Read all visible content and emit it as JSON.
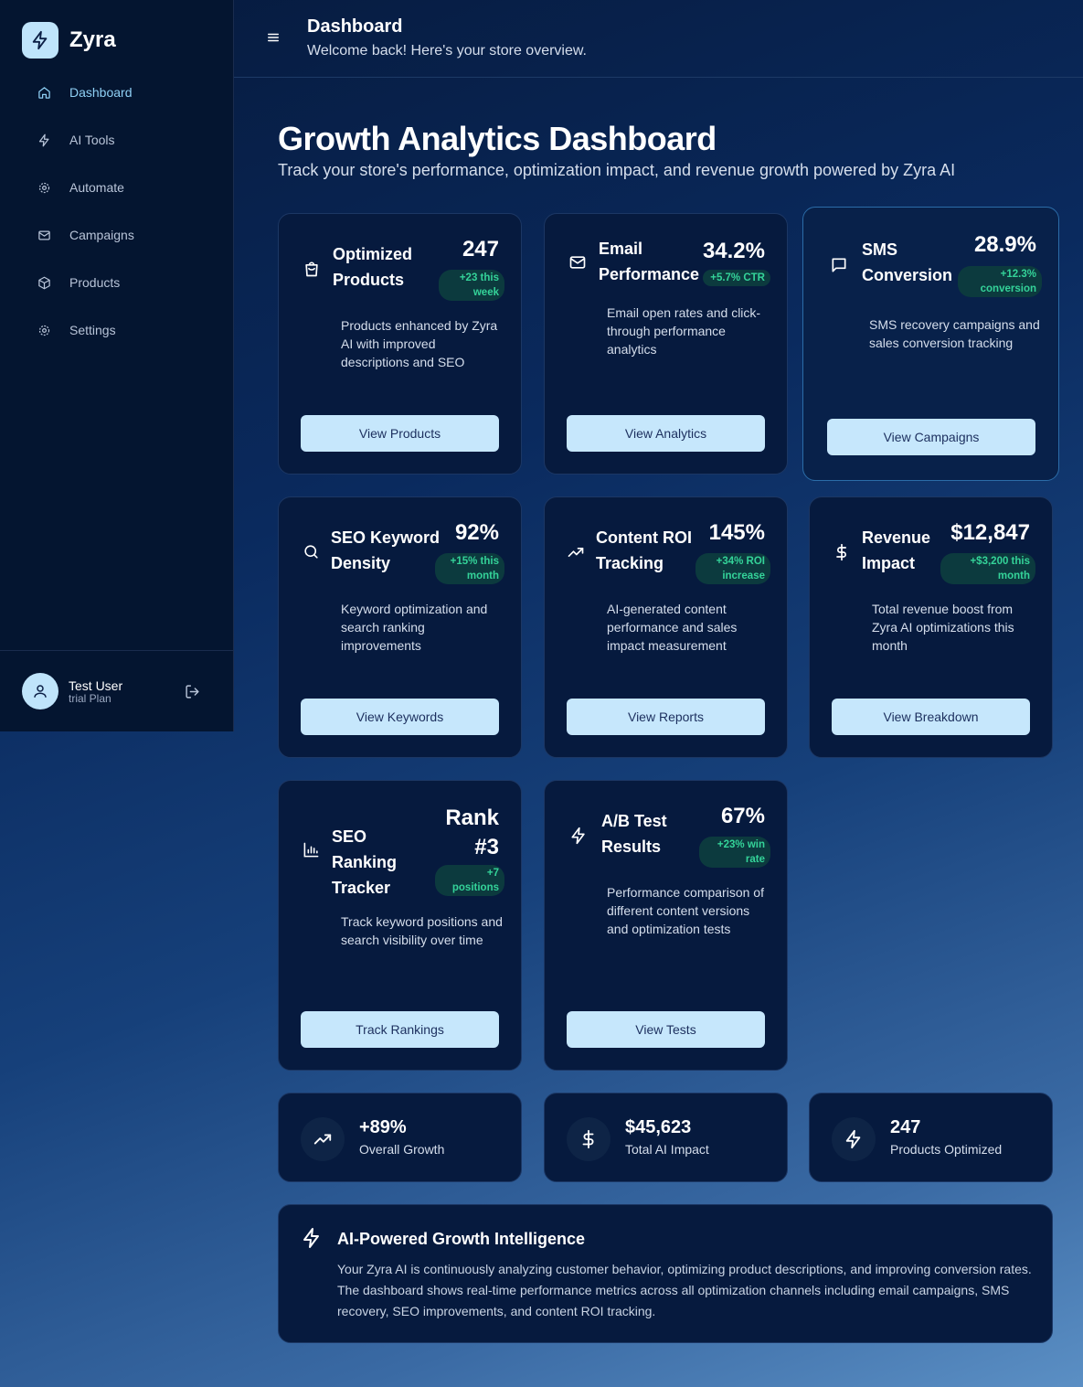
{
  "brand": {
    "name": "Zyra",
    "logo_icon": "lightning-bolt-icon"
  },
  "sidebar": {
    "items": [
      {
        "label": "Dashboard",
        "icon": "home-icon",
        "active": true
      },
      {
        "label": "AI Tools",
        "icon": "lightning-icon"
      },
      {
        "label": "Automate",
        "icon": "gear-icon"
      },
      {
        "label": "Campaigns",
        "icon": "mail-icon"
      },
      {
        "label": "Products",
        "icon": "box-icon"
      },
      {
        "label": "Settings",
        "icon": "settings-icon"
      }
    ],
    "user": {
      "name": "Test User",
      "plan": "trial Plan"
    }
  },
  "header": {
    "title": "Dashboard",
    "subtitle": "Welcome back! Here's your store overview."
  },
  "page": {
    "title": "Growth Analytics Dashboard",
    "subtitle": "Track your store's performance, optimization impact, and revenue growth powered by Zyra AI"
  },
  "cards": [
    {
      "title": "Optimized Products",
      "value": "247",
      "badge": "+23 this week",
      "description": "Products enhanced by Zyra AI with improved descriptions and SEO",
      "button": "View Products",
      "icon": "shopping-bag-icon"
    },
    {
      "title": "Email Performance",
      "value": "34.2%",
      "badge": "+5.7% CTR",
      "description": "Email open rates and click-through performance analytics",
      "button": "View Analytics",
      "icon": "mail-icon"
    },
    {
      "title": "SMS Conversion",
      "value": "28.9%",
      "badge": "+12.3% conversion",
      "description": "SMS recovery campaigns and sales conversion tracking",
      "button": "View Campaigns",
      "icon": "message-icon"
    },
    {
      "title": "SEO Keyword Density",
      "value": "92%",
      "badge": "+15% this month",
      "description": "Keyword optimization and search ranking improvements",
      "button": "View Keywords",
      "icon": "search-icon"
    },
    {
      "title": "Content ROI Tracking",
      "value": "145%",
      "badge": "+34% ROI increase",
      "description": "AI-generated content performance and sales impact measurement",
      "button": "View Reports",
      "icon": "trending-up-icon"
    },
    {
      "title": "Revenue Impact",
      "value": "$12,847",
      "badge": "+$3,200 this month",
      "description": "Total revenue boost from Zyra AI optimizations this month",
      "button": "View Breakdown",
      "icon": "dollar-icon"
    },
    {
      "title": "SEO Ranking Tracker",
      "value": "Rank #3",
      "badge": "+7 positions",
      "description": "Track keyword positions and search visibility over time",
      "button": "Track Rankings",
      "icon": "bar-chart-icon"
    },
    {
      "title": "A/B Test Results",
      "value": "67%",
      "badge": "+23% win rate",
      "description": "Performance comparison of different content versions and optimization tests",
      "button": "View Tests",
      "icon": "lightning-icon"
    }
  ],
  "stats": [
    {
      "value": "+89%",
      "label": "Overall Growth",
      "icon": "trending-up-icon"
    },
    {
      "value": "$45,623",
      "label": "Total AI Impact",
      "icon": "dollar-icon"
    },
    {
      "value": "247",
      "label": "Products Optimized",
      "icon": "lightning-icon"
    }
  ],
  "intelligence": {
    "title": "AI-Powered Growth Intelligence",
    "text": "Your Zyra AI is continuously analyzing customer behavior, optimizing product descriptions, and improving conversion rates. The dashboard shows real-time performance metrics across all optimization channels including email campaigns, SMS recovery, SEO improvements, and content ROI tracking."
  },
  "colors": {
    "accent": "#8fd0f5",
    "button": "#c6e7fc",
    "badge_text": "#34d399",
    "card_bg": "#061a3e"
  }
}
